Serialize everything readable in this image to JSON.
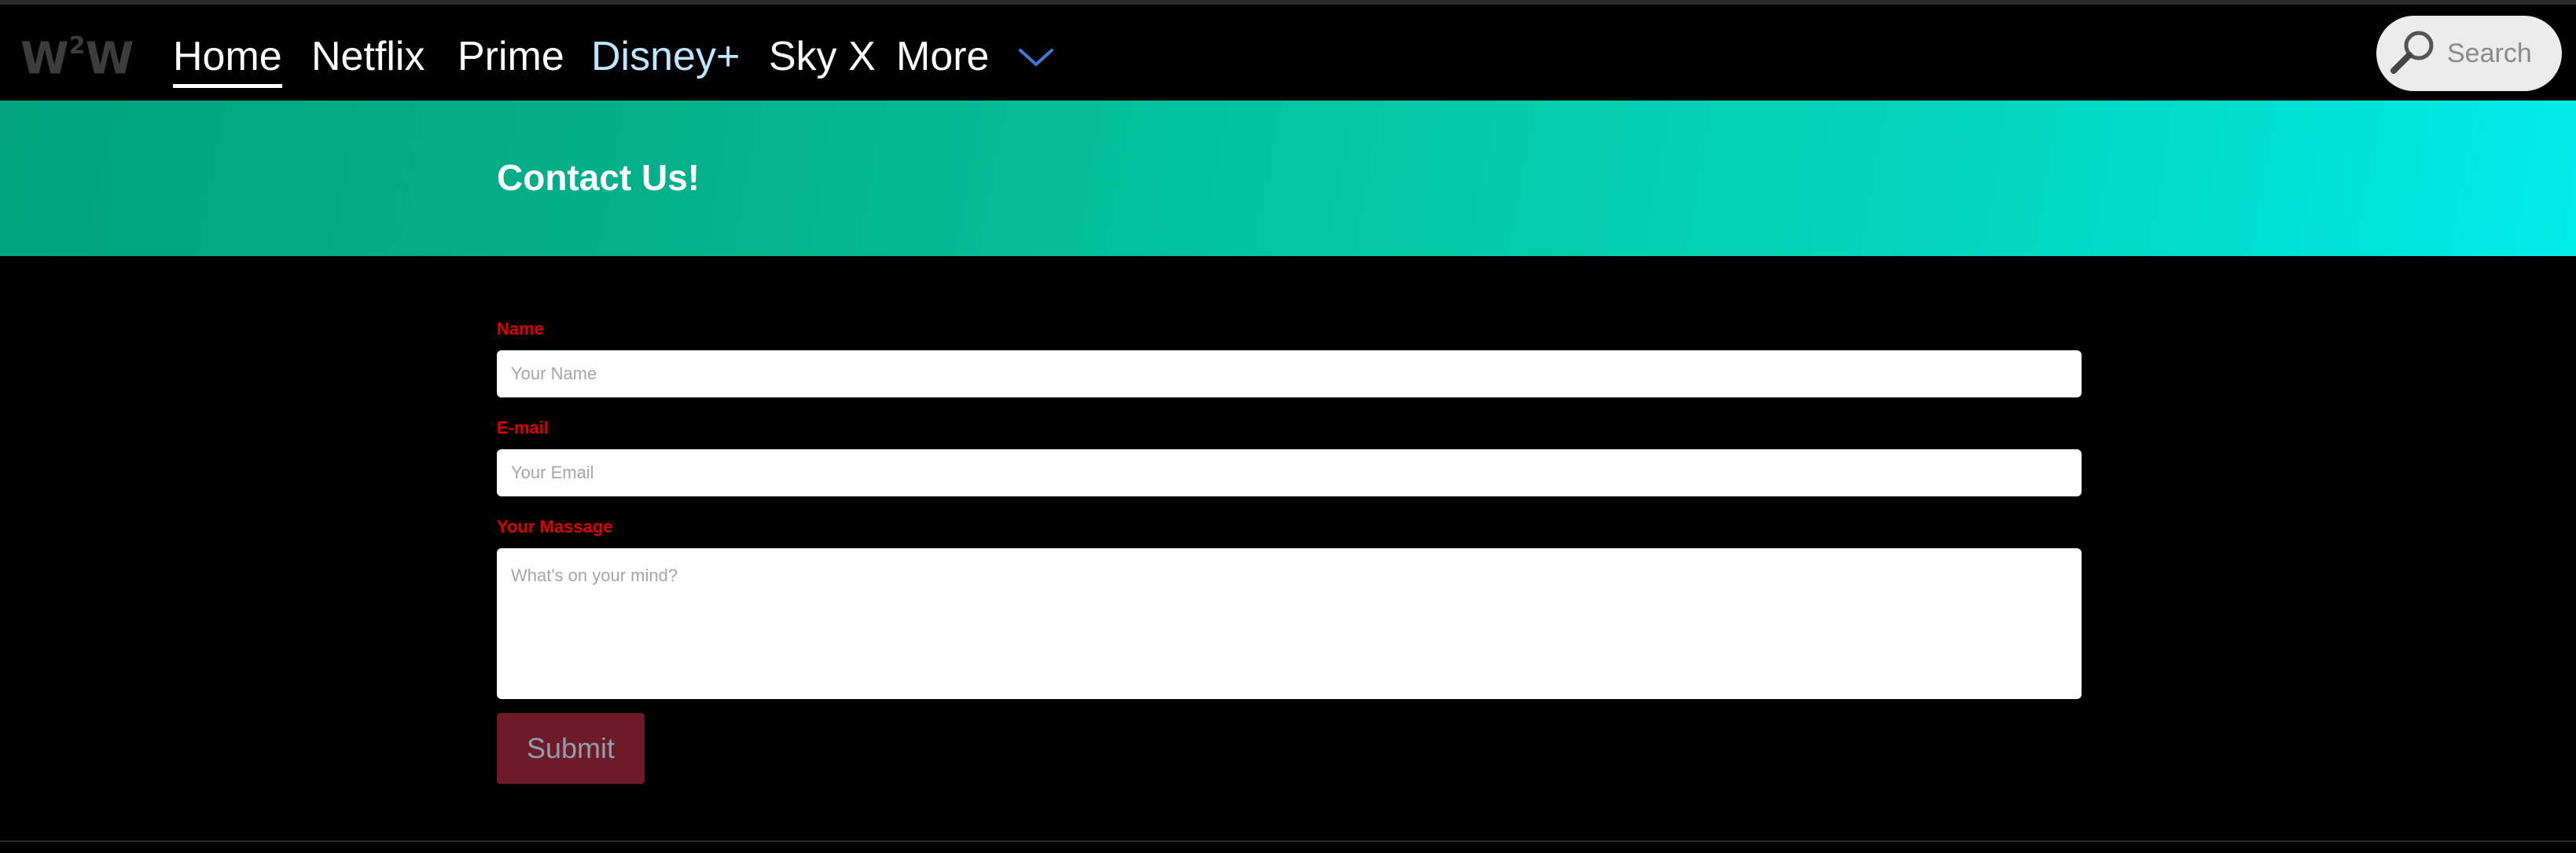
{
  "brand": {
    "logo_left": "W",
    "logo_sup": "2",
    "logo_right": "W"
  },
  "nav": {
    "items": [
      {
        "label": "Home"
      },
      {
        "label": "Netflix"
      },
      {
        "label": "Prime"
      },
      {
        "label": "Disney+"
      },
      {
        "label": "Sky X"
      },
      {
        "label": "More"
      }
    ],
    "active": "Home",
    "more_icon": "chevron-down-icon",
    "chevron_color": "#3a7bd5"
  },
  "search": {
    "placeholder": "Search",
    "icon": "search-icon"
  },
  "hero": {
    "title": "Contact Us!",
    "gradient_start": "#02a37e",
    "gradient_end": "#00ecea"
  },
  "form": {
    "name_label": "Name",
    "name_placeholder": "Your Name",
    "email_label": "E-mail",
    "email_placeholder": "Your Email",
    "message_label": "Your Massage",
    "message_placeholder": "What's on your mind?",
    "submit_label": "Submit",
    "label_color": "#e00000",
    "submit_color": "#6e1a2a"
  }
}
